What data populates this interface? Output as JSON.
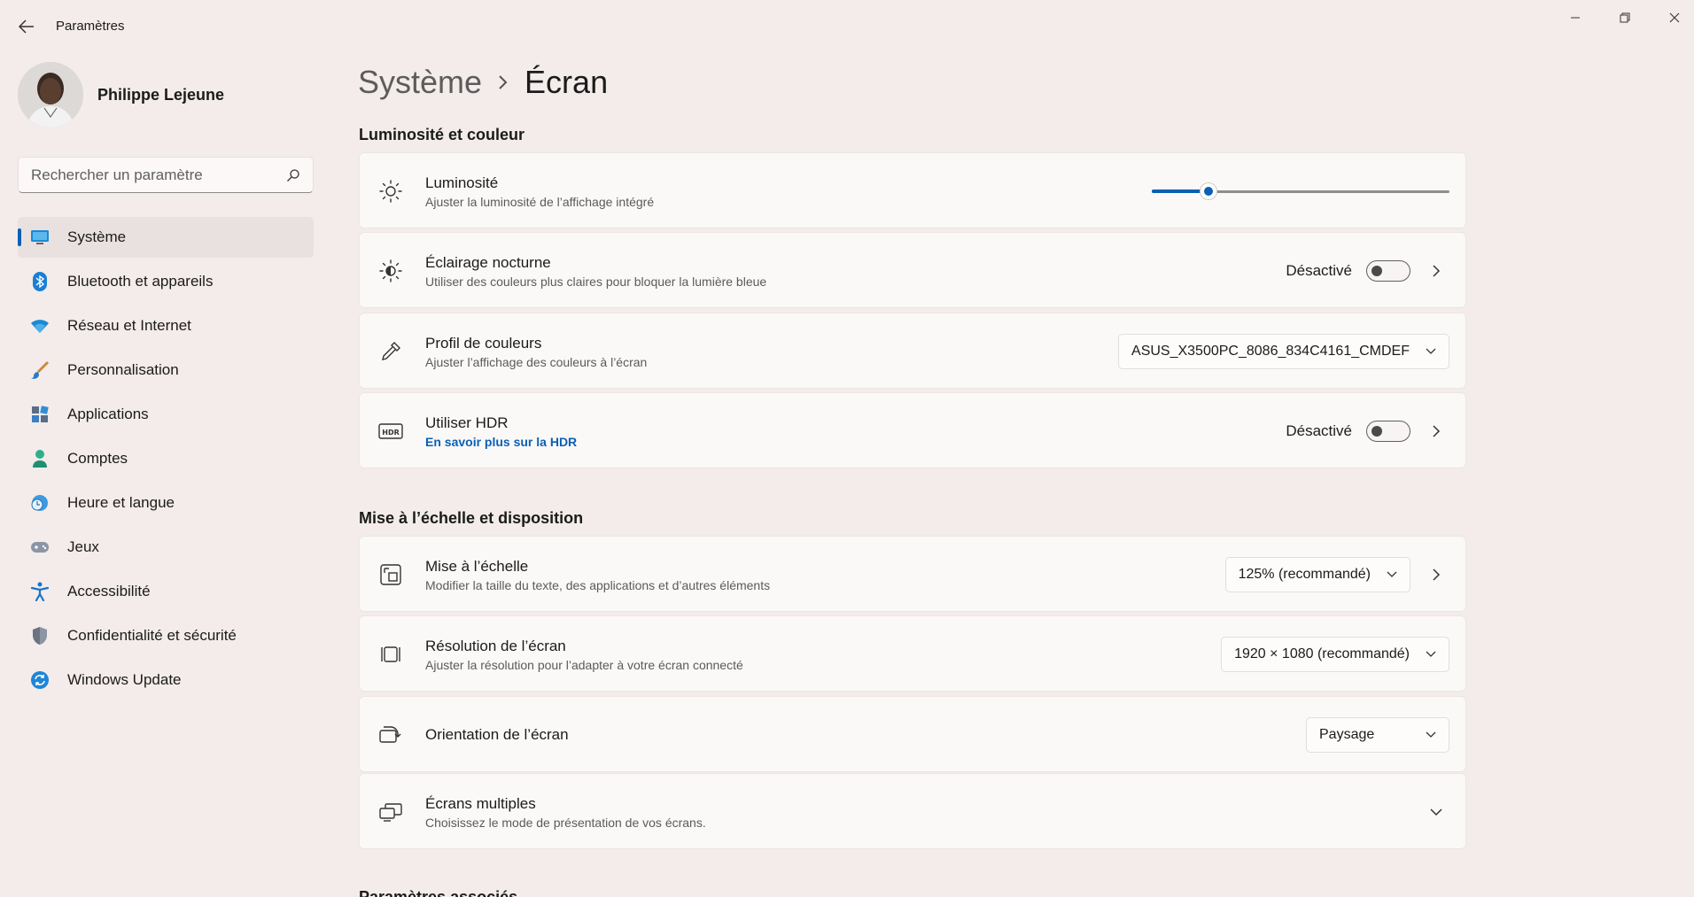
{
  "window": {
    "title": "Paramètres"
  },
  "profile": {
    "name": "Philippe Lejeune"
  },
  "search": {
    "placeholder": "Rechercher un paramètre"
  },
  "sidebar": {
    "items": [
      {
        "label": "Système",
        "icon": "monitor-icon",
        "active": true
      },
      {
        "label": "Bluetooth et appareils",
        "icon": "bluetooth-icon"
      },
      {
        "label": "Réseau et Internet",
        "icon": "wifi-icon"
      },
      {
        "label": "Personnalisation",
        "icon": "brush-icon"
      },
      {
        "label": "Applications",
        "icon": "apps-icon"
      },
      {
        "label": "Comptes",
        "icon": "person-icon"
      },
      {
        "label": "Heure et langue",
        "icon": "globe-clock-icon"
      },
      {
        "label": "Jeux",
        "icon": "gamepad-icon"
      },
      {
        "label": "Accessibilité",
        "icon": "accessibility-icon"
      },
      {
        "label": "Confidentialité et sécurité",
        "icon": "shield-icon"
      },
      {
        "label": "Windows Update",
        "icon": "update-icon"
      }
    ]
  },
  "breadcrumb": {
    "parent": "Système",
    "current": "Écran"
  },
  "sections": {
    "brightness_color": "Luminosité et couleur",
    "scale_layout": "Mise à l’échelle et disposition",
    "related": "Paramètres associés"
  },
  "settings": {
    "brightness": {
      "title": "Luminosité",
      "subtitle": "Ajuster la luminosité de l’affichage intégré",
      "value_percent": 19
    },
    "night_light": {
      "title": "Éclairage nocturne",
      "subtitle": "Utiliser des couleurs plus claires pour bloquer la lumière bleue",
      "status": "Désactivé"
    },
    "color_profile": {
      "title": "Profil de couleurs",
      "subtitle": "Ajuster l’affichage des couleurs à l’écran",
      "value": "ASUS_X3500PC_8086_834C4161_CMDEF"
    },
    "hdr": {
      "title": "Utiliser HDR",
      "link": "En savoir plus sur la HDR",
      "status": "Désactivé"
    },
    "scale": {
      "title": "Mise à l’échelle",
      "subtitle": "Modifier la taille du texte, des applications et d’autres éléments",
      "value": "125% (recommandé)"
    },
    "resolution": {
      "title": "Résolution de l’écran",
      "subtitle": "Ajuster la résolution pour l’adapter à  votre  écran connecté",
      "value": "1920 × 1080 (recommandé)"
    },
    "orientation": {
      "title": "Orientation de l’écran",
      "value": "Paysage"
    },
    "multiple_displays": {
      "title": "Écrans multiples",
      "subtitle": "Choisissez le mode de présentation de vos écrans."
    }
  },
  "colors": {
    "accent": "#0a5fb4",
    "background": "#f3ecea",
    "card": "#fbf9f8"
  }
}
